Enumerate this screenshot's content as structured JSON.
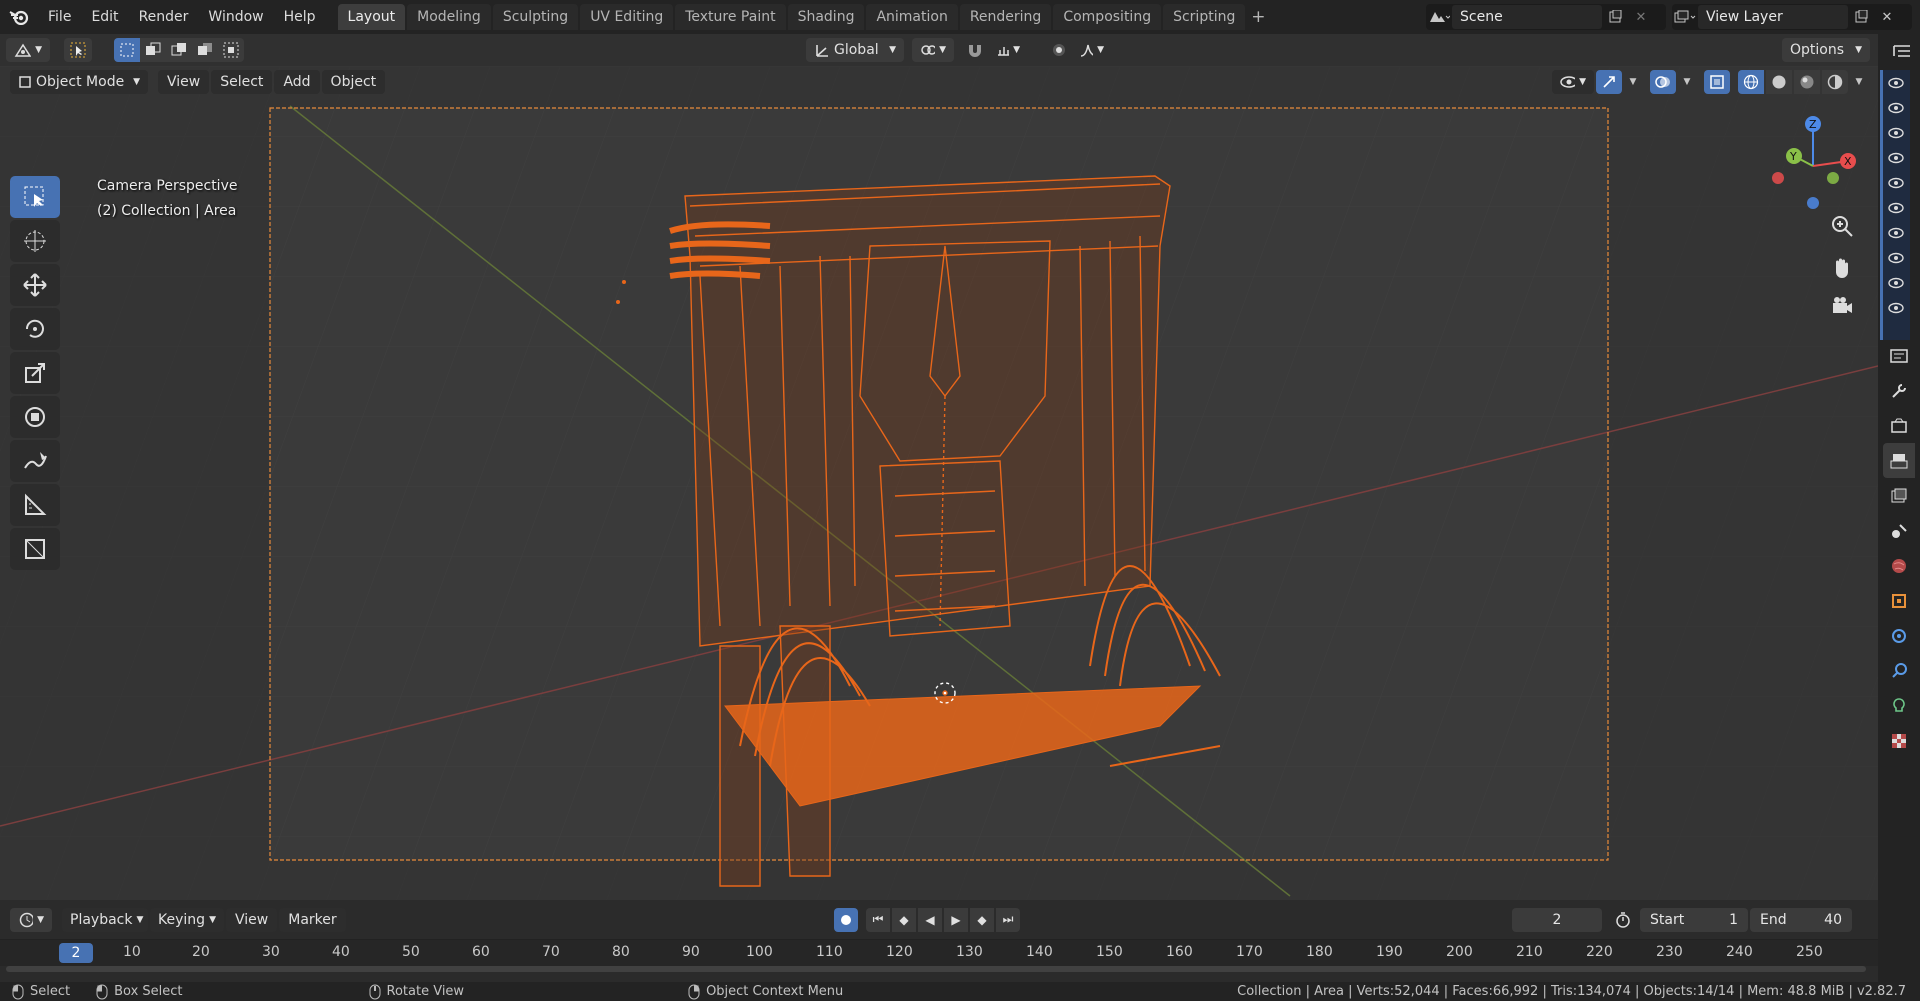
{
  "app": {
    "name": "Blender",
    "version": "v2.82.7"
  },
  "menu": [
    "File",
    "Edit",
    "Render",
    "Window",
    "Help"
  ],
  "workspaces": [
    {
      "label": "Layout",
      "active": true
    },
    {
      "label": "Modeling"
    },
    {
      "label": "Sculpting"
    },
    {
      "label": "UV Editing"
    },
    {
      "label": "Texture Paint"
    },
    {
      "label": "Shading"
    },
    {
      "label": "Animation"
    },
    {
      "label": "Rendering"
    },
    {
      "label": "Compositing"
    },
    {
      "label": "Scripting"
    }
  ],
  "scene": {
    "name": "Scene",
    "view_layer": "View Layer"
  },
  "toolheader": {
    "orientation": "Global",
    "options_label": "Options"
  },
  "viewheader": {
    "mode": "Object Mode",
    "view": "View",
    "select": "Select",
    "add": "Add",
    "object": "Object"
  },
  "viewport": {
    "overlay_title": "Camera Perspective",
    "overlay_sub": "(2) Collection | Area",
    "selection_color": "#e8661a",
    "gizmo_axes": {
      "z": "Z",
      "y": "Y",
      "x": "X"
    }
  },
  "timeline": {
    "playback": "Playback",
    "keying": "Keying",
    "view": "View",
    "marker": "Marker",
    "current_frame": "2",
    "start_label": "Start",
    "start": "1",
    "end_label": "End",
    "end": "40",
    "ruler": [
      "10",
      "20",
      "30",
      "40",
      "50",
      "60",
      "70",
      "80",
      "90",
      "100",
      "110",
      "120",
      "130",
      "140",
      "150",
      "160",
      "170",
      "180",
      "190",
      "200",
      "210",
      "220",
      "230",
      "240",
      "250"
    ]
  },
  "status": {
    "left_select": "Select",
    "box_select": "Box Select",
    "rotate": "Rotate View",
    "context": "Object Context Menu",
    "stats": "Collection | Area | Verts:52,044 | Faces:66,992 | Tris:134,074 | Objects:14/14 | Mem: 48.8 MiB | v2.82.7"
  }
}
